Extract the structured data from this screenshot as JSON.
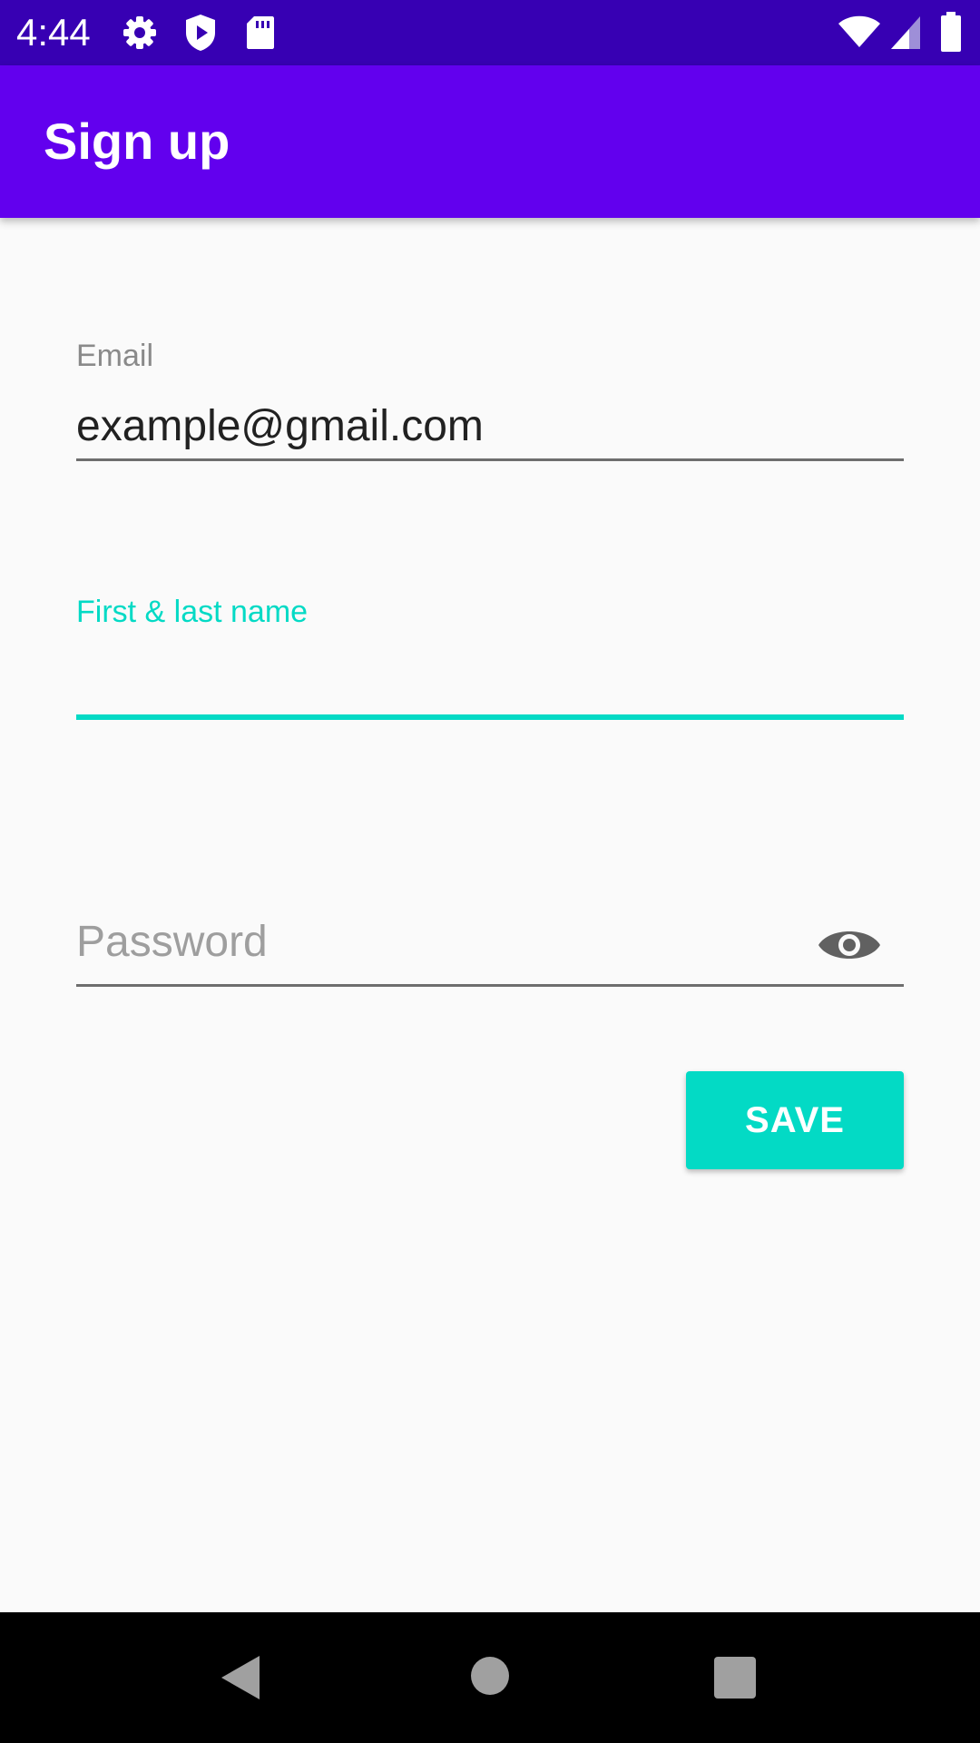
{
  "status_bar": {
    "time": "4:44",
    "left_icons": [
      "gear-icon",
      "shield-play-icon",
      "sd-card-icon"
    ],
    "right_icons": [
      "wifi-icon",
      "signal-icon",
      "battery-icon"
    ],
    "background_color": "#3700b3"
  },
  "app_bar": {
    "title": "Sign up",
    "background_color": "#6200ee"
  },
  "form": {
    "email": {
      "label": "Email",
      "value": "example@gmail.com"
    },
    "name": {
      "label": "First & last name",
      "value": "",
      "focused": true
    },
    "password": {
      "placeholder": "Password",
      "value": "",
      "toggle_icon": "eye-icon"
    },
    "accent_color": "#03dac5"
  },
  "actions": {
    "save_label": "SAVE"
  },
  "nav_bar": {
    "buttons": [
      "back-icon",
      "home-icon",
      "recents-icon"
    ]
  }
}
